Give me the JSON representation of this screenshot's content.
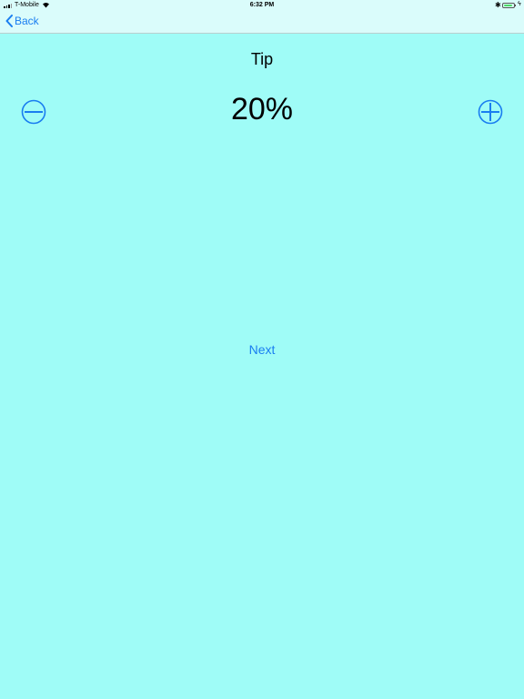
{
  "status_bar": {
    "carrier": "T-Mobile",
    "time": "6:32 PM",
    "battery_level": 0.85
  },
  "nav": {
    "back_label": "Back"
  },
  "main": {
    "title": "Tip",
    "value": "20%",
    "next_label": "Next"
  },
  "colors": {
    "background": "#9ffcf7",
    "accent": "#1a7ef0"
  }
}
